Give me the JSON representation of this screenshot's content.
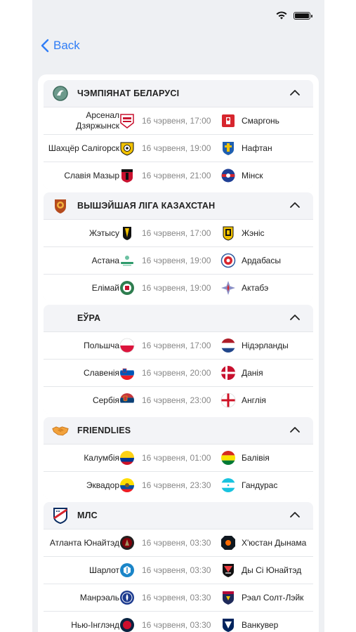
{
  "nav": {
    "back_label": "Back"
  },
  "leagues": [
    {
      "name": "ЧЭМПІЯНАТ БЕЛАРУСІ",
      "logo_icon": "belarus-league-logo",
      "matches": [
        {
          "home": "Арсенал Дзяржынск",
          "time": "16 чэрвеня, 17:00",
          "away": "Смаргонь"
        },
        {
          "home": "Шахцёр Салігорск",
          "time": "16 чэрвеня, 19:00",
          "away": "Нафтан"
        },
        {
          "home": "Славія Мазыр",
          "time": "16 чэрвеня, 21:00",
          "away": "Мінск"
        }
      ]
    },
    {
      "name": "ВЫШЭЙШАЯ ЛІГА КАЗАХСТАН",
      "logo_icon": "kazakhstan-league-logo",
      "matches": [
        {
          "home": "Жэтысу",
          "time": "16 чэрвеня, 17:00",
          "away": "Жэніс"
        },
        {
          "home": "Астана",
          "time": "16 чэрвеня, 19:00",
          "away": "Ардабасы"
        },
        {
          "home": "Елімай",
          "time": "16 чэрвеня, 19:00",
          "away": "Актабэ"
        }
      ]
    },
    {
      "name": "ЕЎРА",
      "logo_icon": "",
      "matches": [
        {
          "home": "Польшча",
          "time": "16 чэрвеня, 17:00",
          "away": "Нідэрланды"
        },
        {
          "home": "Славенія",
          "time": "16 чэрвеня, 20:00",
          "away": "Данія"
        },
        {
          "home": "Сербія",
          "time": "16 чэрвеня, 23:00",
          "away": "Англія"
        }
      ]
    },
    {
      "name": "FRIENDLIES",
      "logo_icon": "handshake-icon",
      "matches": [
        {
          "home": "Калумбія",
          "time": "16 чэрвеня, 01:00",
          "away": "Балівія"
        },
        {
          "home": "Эквадор",
          "time": "16 чэрвеня, 23:30",
          "away": "Гандурас"
        }
      ]
    },
    {
      "name": "МЛС",
      "logo_icon": "mls-logo",
      "matches": [
        {
          "home": "Атланта Юнайтэд",
          "time": "16 чэрвеня, 03:30",
          "away": "Х'юстан Дынама"
        },
        {
          "home": "Шарлот",
          "time": "16 чэрвеня, 03:30",
          "away": "Ды Сі Юнайтэд"
        },
        {
          "home": "Манрэаль",
          "time": "16 чэрвеня, 03:30",
          "away": "Рэал Солт-Лэйк"
        },
        {
          "home": "Нью-Інглэнд",
          "time": "16 чэрвеня, 03:30",
          "away": "Ванкувер"
        }
      ]
    }
  ],
  "colors": {
    "accent": "#2f7df6",
    "header_bg": "#f3f4f7",
    "time_text": "#888888"
  }
}
